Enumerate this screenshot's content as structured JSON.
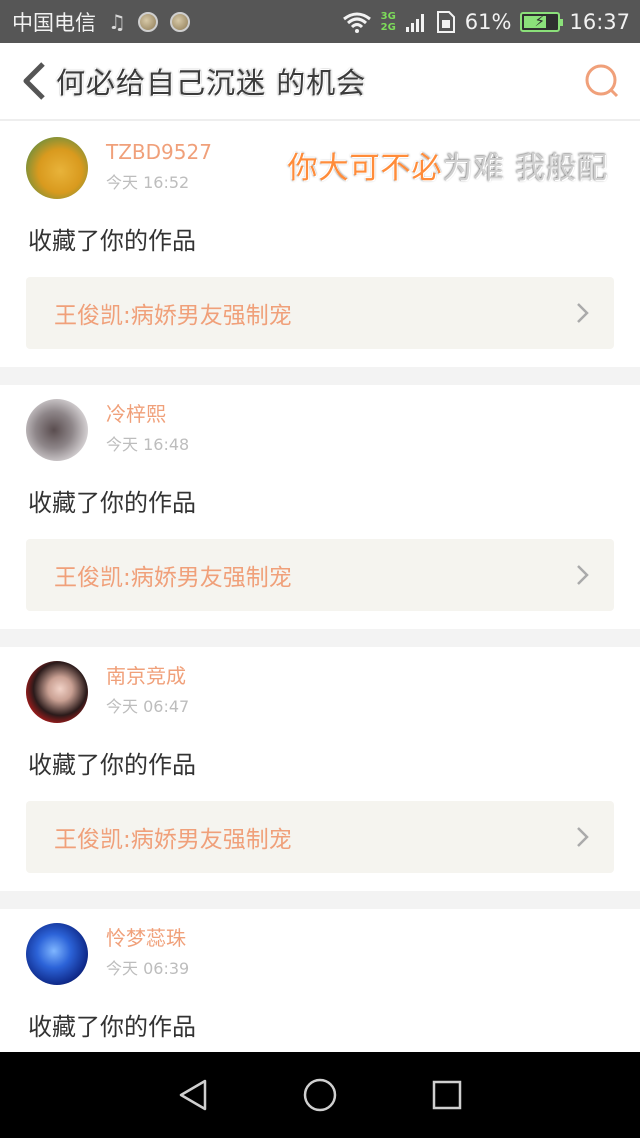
{
  "status_bar": {
    "carrier": "中国电信",
    "music_icon": "music-note-icon",
    "network_top": "3G",
    "network_bottom": "2G",
    "battery_percent": "61%",
    "battery_level": 0.61,
    "time": "16:37"
  },
  "header": {
    "title": "何必给自己沉迷 的机会",
    "back_icon": "back-icon",
    "search_icon": "search-icon"
  },
  "overlay": {
    "orange_text": "你大可不必",
    "grey_text": "为难 我般配"
  },
  "cards": [
    {
      "username": "TZBD9527",
      "timestamp": "今天 16:52",
      "action": "收藏了你的作品",
      "work_title": "王俊凯:病娇男友强制宠"
    },
    {
      "username": "冷梓熙",
      "timestamp": "今天 16:48",
      "action": "收藏了你的作品",
      "work_title": "王俊凯:病娇男友强制宠"
    },
    {
      "username": "南京竞成",
      "timestamp": "今天 06:47",
      "action": "收藏了你的作品",
      "work_title": "王俊凯:病娇男友强制宠"
    },
    {
      "username": "怜梦蕊珠",
      "timestamp": "今天 06:39",
      "action": "收藏了你的作品"
    }
  ],
  "colors": {
    "accent_orange": "#f0a07a",
    "status_bar_bg": "#565656",
    "nav_bar_bg": "#000000"
  }
}
